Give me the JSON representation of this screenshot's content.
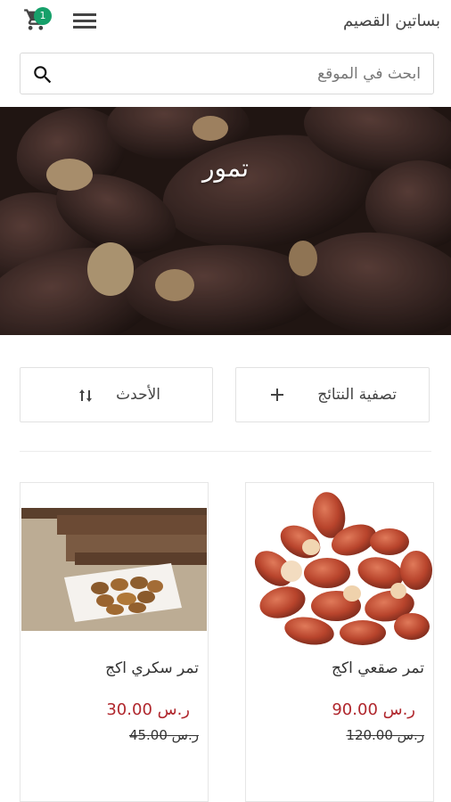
{
  "header": {
    "store_name": "بساتين القصيم",
    "cart_count": "1"
  },
  "search": {
    "placeholder": "ابحث في الموقع"
  },
  "hero": {
    "title": "تمور"
  },
  "toolbar": {
    "filter_label": "تصفية النتائج",
    "sort_label": "الأحدث"
  },
  "products": [
    {
      "name": "تمر صقعي اكج",
      "price": "ر.س 90.00",
      "old_price": "ر.س 120.00"
    },
    {
      "name": "تمر سكري اكج",
      "price": "ر.س 30.00",
      "old_price": "ر.س 45.00"
    }
  ],
  "colors": {
    "badge": "#16a06a",
    "price": "#b0272d",
    "border": "#e2e2e2"
  },
  "icons": [
    "cart-icon",
    "menu-icon",
    "search-icon",
    "plus-icon",
    "sort-icon"
  ]
}
